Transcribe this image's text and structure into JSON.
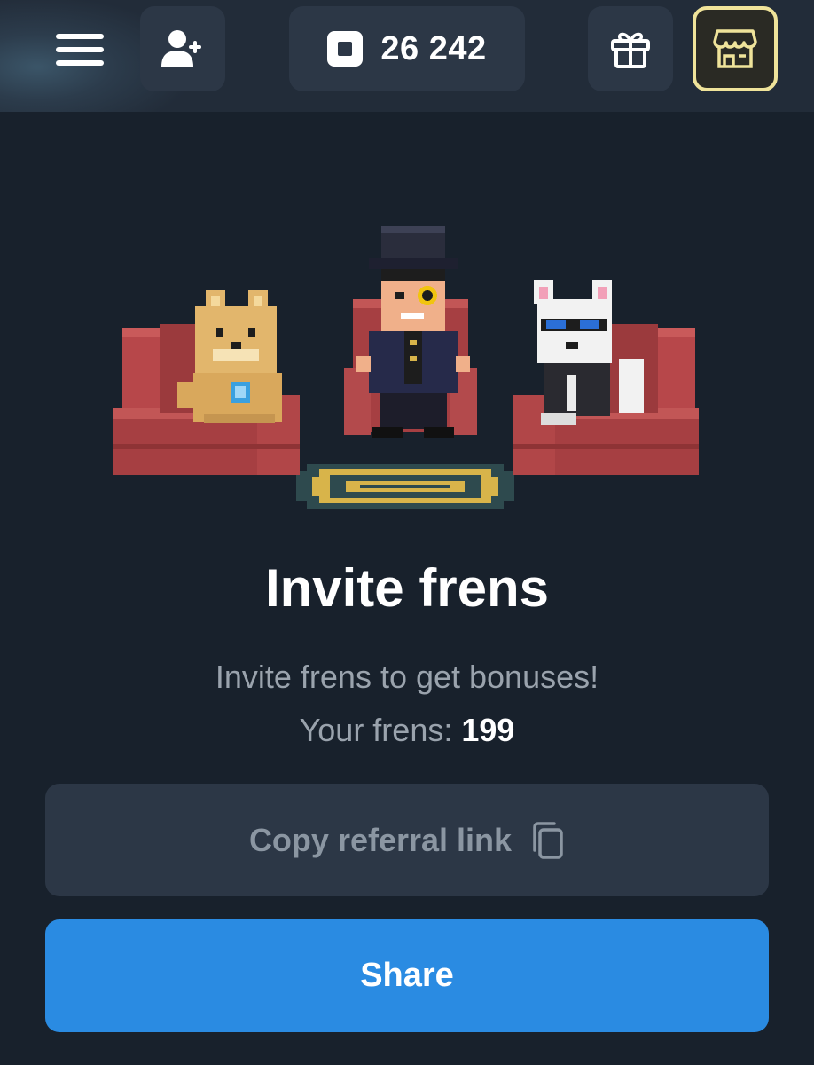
{
  "header": {
    "menu_icon": "hamburger-menu-icon",
    "add_friend_icon": "add-user-icon",
    "balance_icon": "square-coin-icon",
    "balance_value": "26 242",
    "gift_icon": "gift-icon",
    "shop_icon": "store-icon",
    "colors": {
      "bar": "#222c39",
      "button": "#2c3746",
      "shop_border": "#efe39a"
    }
  },
  "main": {
    "title": "Invite frens",
    "subtitle": "Invite frens to get bonuses!",
    "frens_label": "Your frens: ",
    "frens_count": "199"
  },
  "actions": {
    "copy_label": "Copy referral link",
    "copy_icon": "copy-icon",
    "share_label": "Share",
    "colors": {
      "copy_bg": "#2c3746",
      "share_bg": "#2a8be2"
    }
  }
}
